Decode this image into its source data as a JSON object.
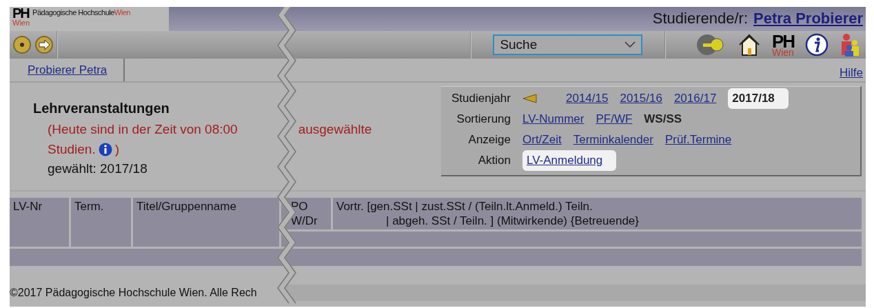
{
  "header": {
    "logo_mark": "PH",
    "logo_mark_sub": "Wien",
    "logo_text": "Pädagogische Hochschule",
    "logo_text_accent": "Wien",
    "user_label": "Studierende/r:",
    "user_name": "Petra Probierer"
  },
  "toolbar": {
    "search_select": "Suche",
    "icon_logo_mark": "PH",
    "icon_logo_sub": "Wien"
  },
  "tabs": [
    {
      "label": "Probierer Petra",
      "selected": true
    }
  ],
  "help_link": "Hilfe",
  "title": "Lehrveranstaltungen",
  "notice": {
    "line1_left": "(Heute sind in der Zeit von 08:00",
    "line1_right": "ausgewählte",
    "line2": "Studien.",
    "line2_end": ")"
  },
  "chosen": "gewählt: 2017/18",
  "options": [
    {
      "label": "Studienjahr",
      "arrow": true,
      "items": [
        {
          "text": "2014/15",
          "kind": "link",
          "highlighted": false
        },
        {
          "text": "2015/16",
          "kind": "link",
          "highlighted": false
        },
        {
          "text": "2016/17",
          "kind": "link",
          "highlighted": false
        },
        {
          "text": "2017/18",
          "kind": "current",
          "highlighted": true
        }
      ]
    },
    {
      "label": "Sortierung",
      "arrow": false,
      "items": [
        {
          "text": "LV-Nummer",
          "kind": "link",
          "highlighted": false
        },
        {
          "text": "PF/WF",
          "kind": "link",
          "highlighted": false
        },
        {
          "text": "WS/SS",
          "kind": "current",
          "highlighted": false
        }
      ]
    },
    {
      "label": "Anzeige",
      "arrow": false,
      "items": [
        {
          "text": "Ort/Zeit",
          "kind": "link",
          "highlighted": false
        },
        {
          "text": "Terminkalender",
          "kind": "link",
          "highlighted": false
        },
        {
          "text": "Prüf.Termine",
          "kind": "link",
          "highlighted": false
        }
      ]
    },
    {
      "label": "Aktion",
      "arrow": false,
      "items": [
        {
          "text": "LV-Anmeldung",
          "kind": "link",
          "highlighted": true
        }
      ]
    }
  ],
  "table": {
    "columns": [
      "LV-Nr",
      "Term.",
      "Titel/Gruppenname"
    ],
    "column_4": [
      "PO",
      "W/Dr"
    ],
    "column_5": [
      "Vortr. [gen.SSt | zust.SSt / (Teiln.lt.Anmeld.) Teiln.",
      "| abgeh. SSt / Teiln. ] (Mitwirkende) {Betreuende}"
    ]
  },
  "footer": "©2017 Pädagogische Hochschule Wien. Alle Rech"
}
